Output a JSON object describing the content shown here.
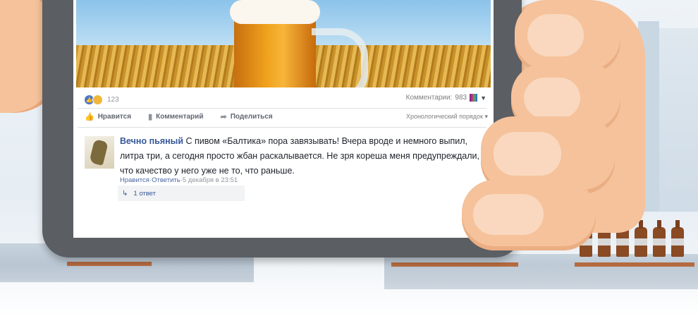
{
  "post": {
    "reactions": {
      "like_icon": "like-icon",
      "haha_icon": "haha-icon",
      "count": "123"
    },
    "comments_control": {
      "label": "Комментарии:",
      "count": "983"
    },
    "actions": {
      "like": "Нравится",
      "comment": "Комментарий",
      "share": "Поделиться"
    },
    "sort_label": "Хронологический порядок"
  },
  "comment": {
    "author": "Вечно пьяный",
    "text": " С пивом «Балтика» пора завязывать! Вчера вроде и немного выпил, литра три, а сегодня просто жбан раскалывается. Не зря кореша меня предупреждали, что качество у него уже не то, что раньше.",
    "like_link": "Нравится",
    "reply_link": "Ответить",
    "separator": " · ",
    "timestamp": "5 декабря в 23:51",
    "replies": "1 ответ"
  },
  "colors": {
    "link": "#365899",
    "muted": "#90949c",
    "skin": "#f5c29b"
  }
}
